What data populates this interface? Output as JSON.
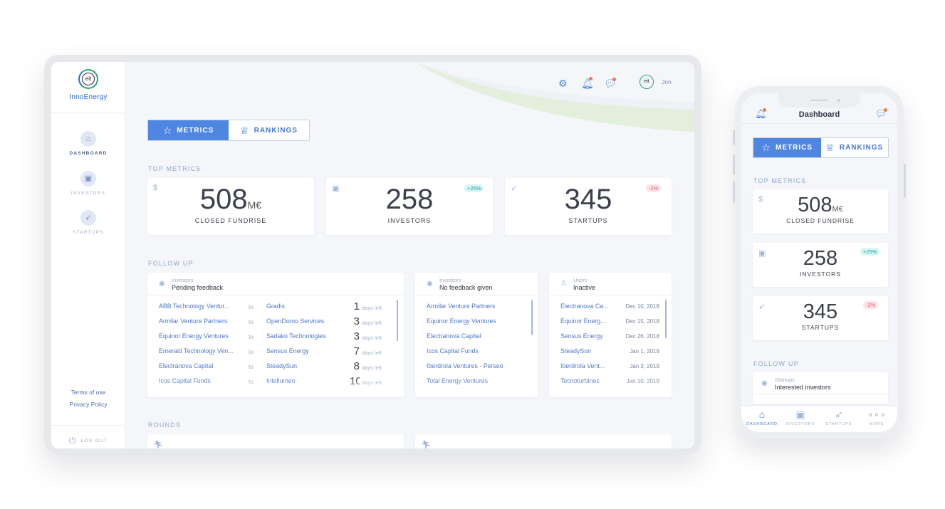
{
  "brand": {
    "logo_mark": "eit",
    "name": "InnoEnergy"
  },
  "sidebar": {
    "items": [
      {
        "label": "DASHBOARD",
        "icon": "home-icon",
        "active": true
      },
      {
        "label": "INVESTORS",
        "icon": "briefcase-icon",
        "active": false
      },
      {
        "label": "STARTUPS",
        "icon": "rocket-icon",
        "active": false
      }
    ],
    "terms": "Terms of use",
    "privacy": "Privacy Policy",
    "logout": "LOG OUT"
  },
  "header": {
    "user_name": "Jon",
    "avatar_text": "eit"
  },
  "tabs": {
    "metrics": "METRICS",
    "rankings": "RANKINGS"
  },
  "sections": {
    "top_metrics": "TOP METRICS",
    "follow_up": "FOLLOW UP",
    "rounds": "ROUNDS"
  },
  "metrics": [
    {
      "icon": "dollar-icon",
      "value": "508",
      "unit": "M€",
      "label": "CLOSED FUNDRISE",
      "badge": ""
    },
    {
      "icon": "briefcase-icon",
      "value": "258",
      "unit": "",
      "label": "INVESTORS",
      "badge": "+25%"
    },
    {
      "icon": "rocket-icon",
      "value": "345",
      "unit": "",
      "label": "STARTUPS",
      "badge": "-2%"
    }
  ],
  "follow_up": {
    "pending": {
      "kind": "Investors",
      "title": "Pending feedback",
      "rows": [
        {
          "from": "ABB Technology Ventur...",
          "to": "Gradis",
          "days": "1",
          "suffix": "days left"
        },
        {
          "from": "Armilar Venture Partners",
          "to": "OpenDomo Services",
          "days": "3",
          "suffix": "days left"
        },
        {
          "from": "Equinor Energy Ventures",
          "to": "Sadako Technologies",
          "days": "3",
          "suffix": "days left"
        },
        {
          "from": "Emerald Technology Ven...",
          "to": "Sensus Energy",
          "days": "7",
          "suffix": "days left"
        },
        {
          "from": "Electranova Capital",
          "to": "SteadySun",
          "days": "8",
          "suffix": "days left"
        },
        {
          "from": "Icos Capital Funds",
          "to": "Intellumen",
          "days": "10",
          "suffix": "days left"
        }
      ],
      "to_word": "to"
    },
    "no_feedback": {
      "kind": "Investors",
      "title": "No feedback given",
      "rows": [
        "Armilar Venture Partners",
        "Equinor Energy Ventures",
        "Electranova Capital",
        "Icos Capital Funds",
        "Iberdrola Ventures - Perseo",
        "Total Energy Ventures"
      ]
    },
    "inactive": {
      "kind": "Users",
      "title": "Inactive",
      "rows": [
        {
          "name": "Electranova Ca...",
          "date": "Dec 10, 2018"
        },
        {
          "name": "Equinor Energ...",
          "date": "Dec 15, 2018"
        },
        {
          "name": "Sensus Energy",
          "date": "Dec 26, 2018"
        },
        {
          "name": "SteadySun",
          "date": "Jan 1, 2019"
        },
        {
          "name": "Iberdrola Vent...",
          "date": "Jan 3, 2019"
        },
        {
          "name": "Tecnoturbines",
          "date": "Jan 10, 2019"
        }
      ]
    }
  },
  "phone": {
    "title": "Dashboard",
    "follow_kind": "Startups",
    "follow_title": "Interested investors",
    "nav": [
      {
        "label": "DASHBOARD",
        "icon": "home-icon"
      },
      {
        "label": "INVESTORS",
        "icon": "briefcase-icon"
      },
      {
        "label": "STARTUPS",
        "icon": "rocket-icon"
      },
      {
        "label": "MORE",
        "icon": "more-dots-icon"
      }
    ]
  },
  "colors": {
    "accent": "#4f86e2",
    "positive": "#19a39a",
    "negative": "#e0566f",
    "brand_green": "#2ba56b"
  }
}
